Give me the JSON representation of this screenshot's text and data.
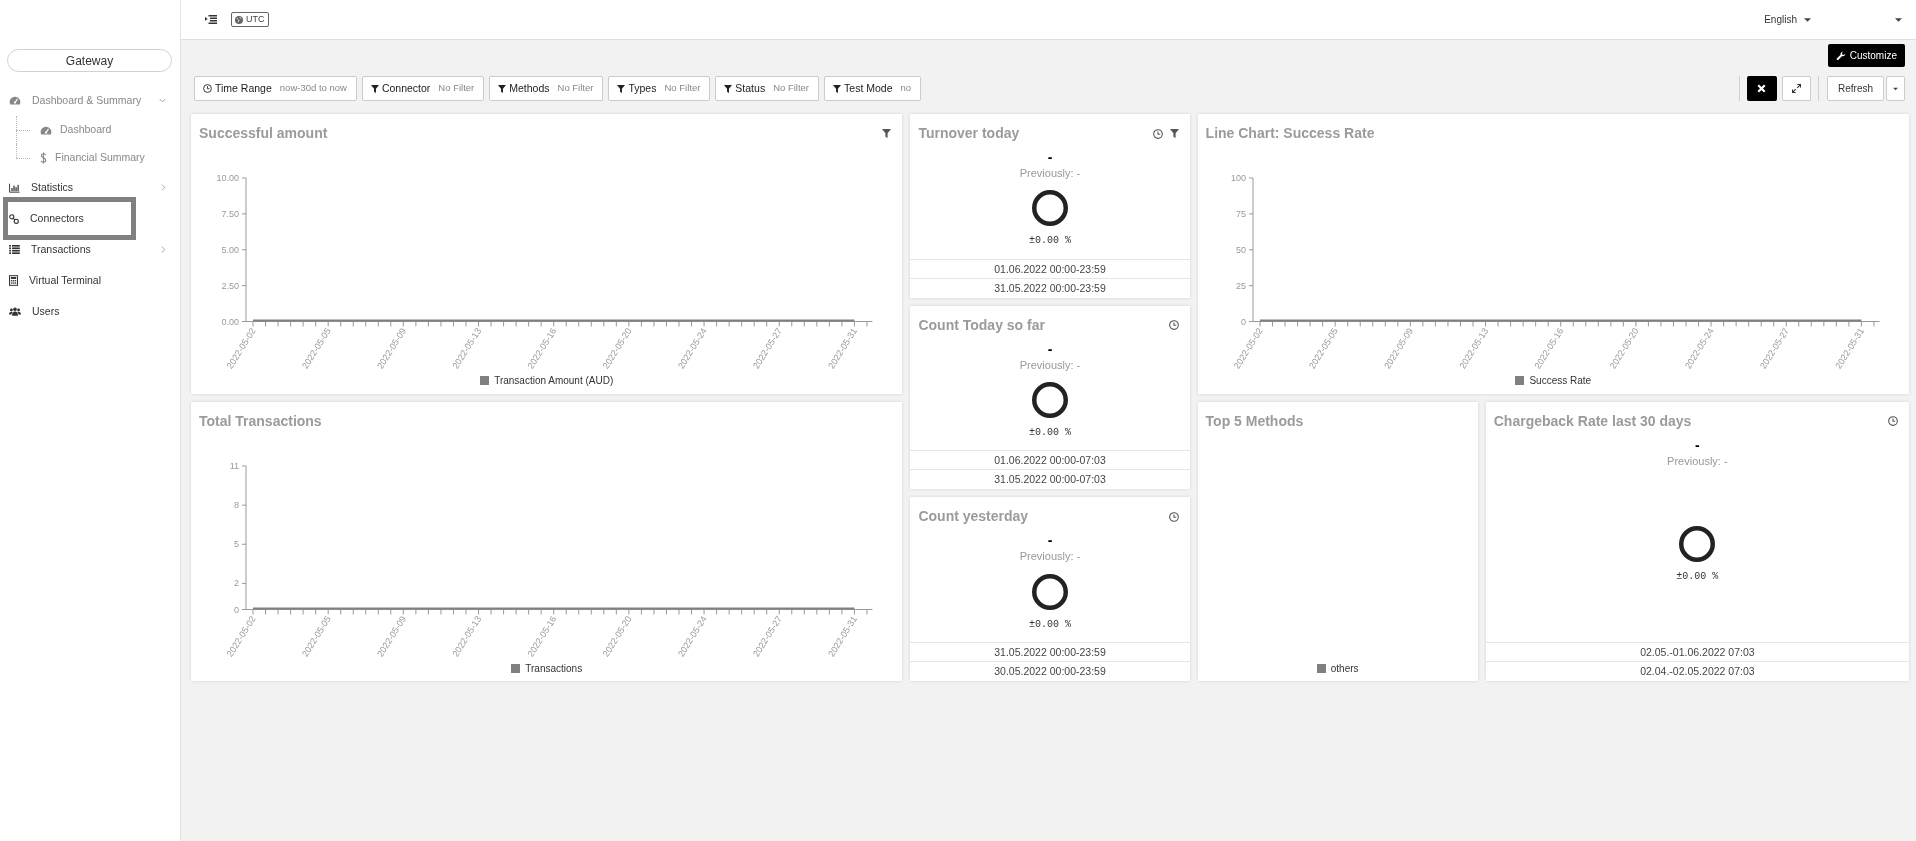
{
  "sidebar": {
    "brand_button": "Gateway",
    "items": [
      {
        "kind": "group",
        "label": "Dashboard & Summary",
        "expanded": true,
        "selected": false,
        "children": [
          {
            "label": "Dashboard",
            "selected": false
          },
          {
            "label": "Financial Summary",
            "selected": false
          }
        ]
      },
      {
        "kind": "group",
        "label": "Statistics",
        "expanded": false,
        "selected": false
      },
      {
        "kind": "link",
        "label": "Connectors",
        "selected": true
      },
      {
        "kind": "group",
        "label": "Transactions",
        "expanded": false,
        "selected": false
      },
      {
        "kind": "link",
        "label": "Virtual Terminal",
        "selected": false
      },
      {
        "kind": "link",
        "label": "Users",
        "selected": false
      }
    ]
  },
  "top_bar": {
    "timezone": "UTC",
    "language": "English"
  },
  "toolbar": {
    "customize_button": "Customize",
    "filters": [
      {
        "kind": "time",
        "label": "Time Range",
        "value": "now-30d to now"
      },
      {
        "kind": "filter",
        "label": "Connector",
        "value": "No Filter"
      },
      {
        "kind": "filter",
        "label": "Methods",
        "value": "No Filter"
      },
      {
        "kind": "filter",
        "label": "Types",
        "value": "No Filter"
      },
      {
        "kind": "filter",
        "label": "Status",
        "value": "No Filter"
      },
      {
        "kind": "filter",
        "label": "Test Mode",
        "value": "no"
      }
    ],
    "refresh_button": "Refresh"
  },
  "left_panels": [
    {
      "kind": "chart",
      "title": "Successful amount",
      "timed": false,
      "filtered": true,
      "chart_data": {
        "type": "line",
        "x": [
          "2022-05-02",
          "2022-05-05",
          "2022-05-09",
          "2022-05-13",
          "2022-05-16",
          "2022-05-20",
          "2022-05-24",
          "2022-05-27",
          "2022-05-31"
        ],
        "series": [
          {
            "name": "Transaction Amount (AUD)",
            "color": "#808080",
            "values": [
              0,
              0,
              0,
              0,
              0,
              0,
              0,
              0,
              0
            ]
          }
        ],
        "ylim": [
          0,
          10
        ],
        "yticks": [
          {
            "value": 0,
            "label": "0.00"
          },
          {
            "value": 2.5,
            "label": "2.50"
          },
          {
            "value": 5,
            "label": "5.00"
          },
          {
            "value": 7.5,
            "label": "7.50"
          },
          {
            "value": 10,
            "label": "10.00"
          }
        ]
      }
    },
    {
      "kind": "chart",
      "title": "Total Transactions",
      "timed": false,
      "filtered": false,
      "chart_data": {
        "type": "line",
        "x": [
          "2022-05-02",
          "2022-05-05",
          "2022-05-09",
          "2022-05-13",
          "2022-05-16",
          "2022-05-20",
          "2022-05-24",
          "2022-05-27",
          "2022-05-31"
        ],
        "series": [
          {
            "name": "Transactions",
            "color": "#808080",
            "values": [
              0,
              0,
              0,
              0,
              0,
              0,
              0,
              0,
              0
            ]
          }
        ],
        "ylim": [
          0,
          11
        ],
        "yticks": [
          0,
          2,
          5,
          8,
          11
        ]
      }
    }
  ],
  "middle_panels": [
    {
      "kind": "kpi",
      "title": "Turnover today",
      "timed": true,
      "filtered": true,
      "value": "-",
      "previous": "Previously: -",
      "change": "±0.00 %",
      "periods": [
        "01.06.2022 00:00-23:59",
        "31.05.2022 00:00-23:59"
      ]
    },
    {
      "kind": "kpi",
      "title": "Count Today so far",
      "timed": true,
      "filtered": false,
      "value": "-",
      "previous": "Previously: -",
      "change": "±0.00 %",
      "periods": [
        "01.06.2022 00:00-07:03",
        "31.05.2022 00:00-07:03"
      ]
    },
    {
      "kind": "kpi",
      "title": "Count yesterday",
      "timed": true,
      "filtered": false,
      "value": "-",
      "previous": "Previously: -",
      "change": "±0.00 %",
      "periods": [
        "31.05.2022 00:00-23:59",
        "30.05.2022 00:00-23:59"
      ]
    }
  ],
  "right_panels": [
    {
      "kind": "chart",
      "title": "Line Chart: Success Rate",
      "timed": false,
      "filtered": false,
      "chart_data": {
        "type": "line",
        "x": [
          "2022-05-02",
          "2022-05-05",
          "2022-05-09",
          "2022-05-13",
          "2022-05-16",
          "2022-05-20",
          "2022-05-24",
          "2022-05-27",
          "2022-05-31"
        ],
        "series": [
          {
            "name": "Success Rate",
            "color": "#808080",
            "values": [
              0,
              0,
              0,
              0,
              0,
              0,
              0,
              0,
              0
            ]
          }
        ],
        "ylim": [
          0,
          100
        ],
        "yticks": [
          0,
          25,
          50,
          75,
          100
        ]
      }
    },
    {
      "kind": "pie",
      "title": "Top 5 Methods",
      "timed": false,
      "filtered": false,
      "legend": [
        "others"
      ]
    },
    {
      "kind": "kpi",
      "title": "Chargeback Rate last 30 days",
      "timed": true,
      "filtered": false,
      "value": "-",
      "previous": "Previously: -",
      "change": "±0.00 %",
      "periods": [
        "02.05.-01.06.2022 07:03",
        "02.04.-02.05.2022 07:03"
      ]
    }
  ]
}
